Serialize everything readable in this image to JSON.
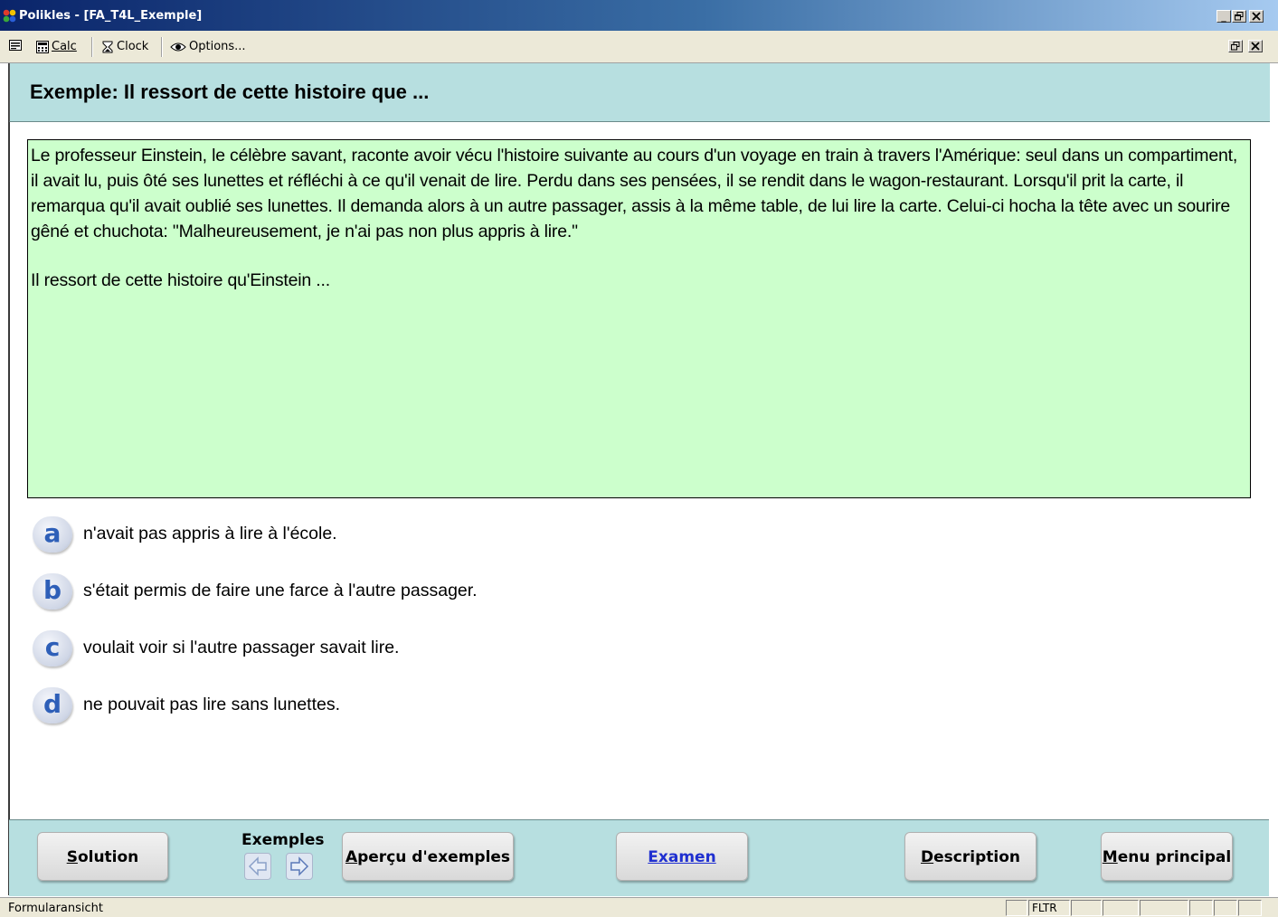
{
  "window": {
    "title": "Polikles - [FA_T4L_Exemple]",
    "minimize": "_",
    "restore": "3",
    "close": "×"
  },
  "menubar": {
    "calc_label": "Calc",
    "clock_label": "Clock",
    "options_label": "Options..."
  },
  "header": {
    "title": "Exemple: Il ressort de cette histoire que ..."
  },
  "passage": {
    "text": "Le professeur Einstein, le célèbre savant, raconte avoir vécu l'histoire suivante au cours d'un voyage en train à travers l'Amérique: seul dans un compartiment, il avait lu, puis ôté ses lunettes et réfléchi à ce qu'il venait de lire. Perdu dans ses pensées, il se rendit dans le wagon-restaurant. Lorsqu'il prit la carte, il remarqua qu'il avait oublié ses lunettes. Il demanda alors à un autre passager, assis à la même table, de lui lire la carte. Celui-ci hocha la tête avec un sourire gêné et chuchota: \"Malheureusement, je n'ai pas non plus appris à lire.\"",
    "question": "Il ressort de cette histoire qu'Einstein ..."
  },
  "options": [
    {
      "letter": "a",
      "text": "n'avait pas appris à lire à l'école."
    },
    {
      "letter": "b",
      "text": "s'était permis de faire une farce à l'autre passager."
    },
    {
      "letter": "c",
      "text": "voulait voir si l'autre passager savait lire."
    },
    {
      "letter": "d",
      "text": "ne pouvait pas lire sans lunettes."
    }
  ],
  "footer": {
    "solution_first": "S",
    "solution_rest": "olution",
    "exemples_label": "Exemples",
    "apercu_first": "A",
    "apercu_rest": "perçu d'exemples",
    "examen_label": "Examen",
    "description_first": "D",
    "description_rest": "escription",
    "menu_first": "M",
    "menu_rest": "enu principal"
  },
  "statusbar": {
    "view_label": "Formularansicht",
    "fltr": "FLTR"
  },
  "colors": {
    "header_bg": "#b7dfe0",
    "passage_bg": "#ccffcc",
    "option_letter": "#2e5fb8",
    "link_button": "#1f2fd0"
  }
}
